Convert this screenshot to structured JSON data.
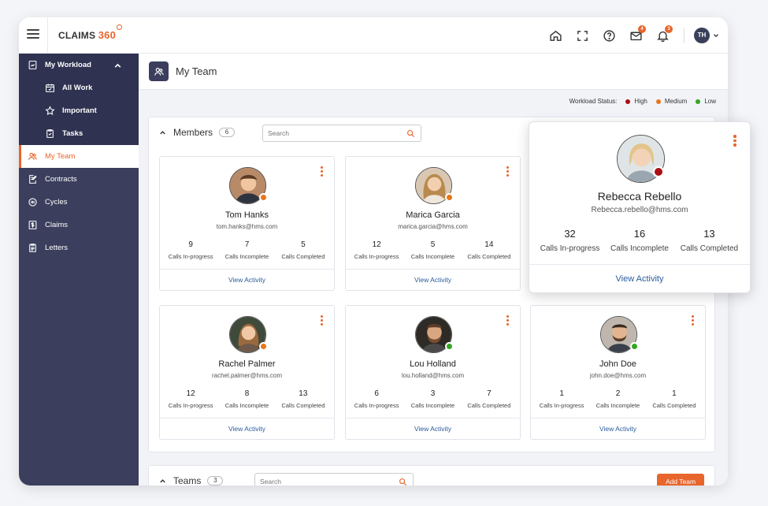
{
  "app": {
    "logo_text": "CLAIMS",
    "logo_num": "360",
    "user_initials": "TH"
  },
  "topbar": {
    "mail_badge": "4",
    "bell_badge": "3"
  },
  "sidebar": {
    "group_label": "My Workload",
    "sub_items": [
      {
        "label": "All Work"
      },
      {
        "label": "Important"
      },
      {
        "label": "Tasks"
      }
    ],
    "items": [
      {
        "label": "My Team"
      },
      {
        "label": "Contracts"
      },
      {
        "label": "Cycles"
      },
      {
        "label": "Claims"
      },
      {
        "label": "Letters"
      }
    ]
  },
  "page": {
    "title": "My Team"
  },
  "workload": {
    "label": "Workload Status:",
    "levels": [
      {
        "label": "High",
        "color": "#a80e14"
      },
      {
        "label": "Medium",
        "color": "#e8761b"
      },
      {
        "label": "Low",
        "color": "#34a524"
      }
    ]
  },
  "members": {
    "title": "Members",
    "count": "6",
    "search_placeholder": "Search"
  },
  "stat_labels": {
    "inprog": "Calls In-progress",
    "incomplete": "Calls Incomplete",
    "completed": "Calls Completed"
  },
  "view_activity": "View Activity",
  "cards": [
    {
      "name": "Tom Hanks",
      "email": "tom.hanks@hms.com",
      "inprog": "9",
      "incomplete": "7",
      "completed": "5",
      "status": "Medium",
      "status_color": "#e8761b"
    },
    {
      "name": "Marica Garcia",
      "email": "marica.garcia@hms.com",
      "inprog": "12",
      "incomplete": "5",
      "completed": "14",
      "status": "Medium",
      "status_color": "#e8761b"
    },
    {
      "name": "Rachel Palmer",
      "email": "rachel.palmer@hms.com",
      "inprog": "12",
      "incomplete": "8",
      "completed": "13",
      "status": "Medium",
      "status_color": "#e8761b"
    },
    {
      "name": "Lou Holland",
      "email": "lou.holland@hms.com",
      "inprog": "6",
      "incomplete": "3",
      "completed": "7",
      "status": "Low",
      "status_color": "#34a524"
    },
    {
      "name": "John Doe",
      "email": "john.doe@hms.com",
      "inprog": "1",
      "incomplete": "2",
      "completed": "1",
      "status": "Low",
      "status_color": "#34a524"
    }
  ],
  "popup": {
    "name": "Rebecca Rebello",
    "email": "Rebecca.rebello@hms.com",
    "inprog": "32",
    "incomplete": "16",
    "completed": "13",
    "status": "High",
    "status_color": "#a80e14"
  },
  "teams": {
    "title": "Teams",
    "count": "3",
    "search_placeholder": "Search",
    "add_label": "Add Team"
  }
}
